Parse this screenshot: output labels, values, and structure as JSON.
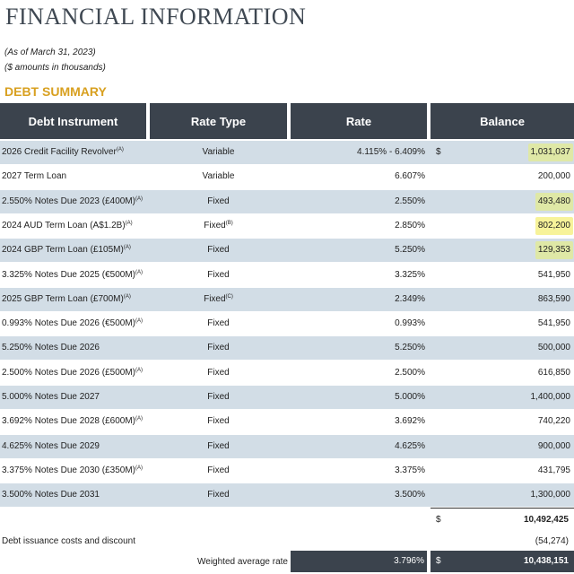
{
  "title": "FINANCIAL INFORMATION",
  "note_date": "(As of March 31, 2023)",
  "note_units": "($ amounts in thousands)",
  "section_title": "DEBT SUMMARY",
  "headers": {
    "instrument": "Debt Instrument",
    "rate_type": "Rate Type",
    "rate": "Rate",
    "balance": "Balance"
  },
  "rows": [
    {
      "instrument": "2026 Credit Facility Revolver",
      "sup": "(A)",
      "rate_type": "Variable",
      "type_sup": "",
      "rate": "4.115% - 6.409%",
      "dollar": "$",
      "balance": "1,031,037",
      "highlight": "green"
    },
    {
      "instrument": "2027 Term Loan",
      "sup": "",
      "rate_type": "Variable",
      "type_sup": "",
      "rate": "6.607%",
      "dollar": "",
      "balance": "200,000",
      "highlight": ""
    },
    {
      "instrument": "2.550% Notes Due 2023 (£400M)",
      "sup": "(A)",
      "rate_type": "Fixed",
      "type_sup": "",
      "rate": "2.550%",
      "dollar": "",
      "balance": "493,480",
      "highlight": "green"
    },
    {
      "instrument": "2024 AUD Term Loan (A$1.2B)",
      "sup": "(A)",
      "rate_type": "Fixed",
      "type_sup": "(B)",
      "rate": "2.850%",
      "dollar": "",
      "balance": "802,200",
      "highlight": "yellow"
    },
    {
      "instrument": "2024 GBP Term Loan (£105M)",
      "sup": "(A)",
      "rate_type": "Fixed",
      "type_sup": "",
      "rate": "5.250%",
      "dollar": "",
      "balance": "129,353",
      "highlight": "green"
    },
    {
      "instrument": "3.325% Notes Due 2025 (€500M)",
      "sup": "(A)",
      "rate_type": "Fixed",
      "type_sup": "",
      "rate": "3.325%",
      "dollar": "",
      "balance": "541,950",
      "highlight": ""
    },
    {
      "instrument": "2025 GBP Term Loan (£700M)",
      "sup": "(A)",
      "rate_type": "Fixed",
      "type_sup": "(C)",
      "rate": "2.349%",
      "dollar": "",
      "balance": "863,590",
      "highlight": ""
    },
    {
      "instrument": "0.993% Notes Due 2026 (€500M)",
      "sup": "(A)",
      "rate_type": "Fixed",
      "type_sup": "",
      "rate": "0.993%",
      "dollar": "",
      "balance": "541,950",
      "highlight": ""
    },
    {
      "instrument": "5.250% Notes Due 2026",
      "sup": "",
      "rate_type": "Fixed",
      "type_sup": "",
      "rate": "5.250%",
      "dollar": "",
      "balance": "500,000",
      "highlight": ""
    },
    {
      "instrument": "2.500% Notes Due 2026 (£500M)",
      "sup": "(A)",
      "rate_type": "Fixed",
      "type_sup": "",
      "rate": "2.500%",
      "dollar": "",
      "balance": "616,850",
      "highlight": ""
    },
    {
      "instrument": "5.000% Notes Due 2027",
      "sup": "",
      "rate_type": "Fixed",
      "type_sup": "",
      "rate": "5.000%",
      "dollar": "",
      "balance": "1,400,000",
      "highlight": ""
    },
    {
      "instrument": "3.692% Notes Due 2028 (£600M)",
      "sup": "(A)",
      "rate_type": "Fixed",
      "type_sup": "",
      "rate": "3.692%",
      "dollar": "",
      "balance": "740,220",
      "highlight": ""
    },
    {
      "instrument": "4.625% Notes Due 2029",
      "sup": "",
      "rate_type": "Fixed",
      "type_sup": "",
      "rate": "4.625%",
      "dollar": "",
      "balance": "900,000",
      "highlight": ""
    },
    {
      "instrument": "3.375% Notes Due 2030 (£350M)",
      "sup": "(A)",
      "rate_type": "Fixed",
      "type_sup": "",
      "rate": "3.375%",
      "dollar": "",
      "balance": "431,795",
      "highlight": ""
    },
    {
      "instrument": "3.500% Notes Due 2031",
      "sup": "",
      "rate_type": "Fixed",
      "type_sup": "",
      "rate": "3.500%",
      "dollar": "",
      "balance": "1,300,000",
      "highlight": ""
    }
  ],
  "subtotal": {
    "dollar": "$",
    "value": "10,492,425"
  },
  "issuance": {
    "label": "Debt issuance costs and discount",
    "value": "(54,274)"
  },
  "weighted": {
    "label": "Weighted average rate",
    "rate": "3.796%",
    "dollar": "$",
    "value": "10,438,151"
  },
  "colors": {
    "header_bg": "#3b434d",
    "row_shade": "#d2dde6",
    "section_accent": "#d8a020",
    "highlight_green": "#dfe8a6",
    "highlight_yellow": "#f7f39a"
  }
}
